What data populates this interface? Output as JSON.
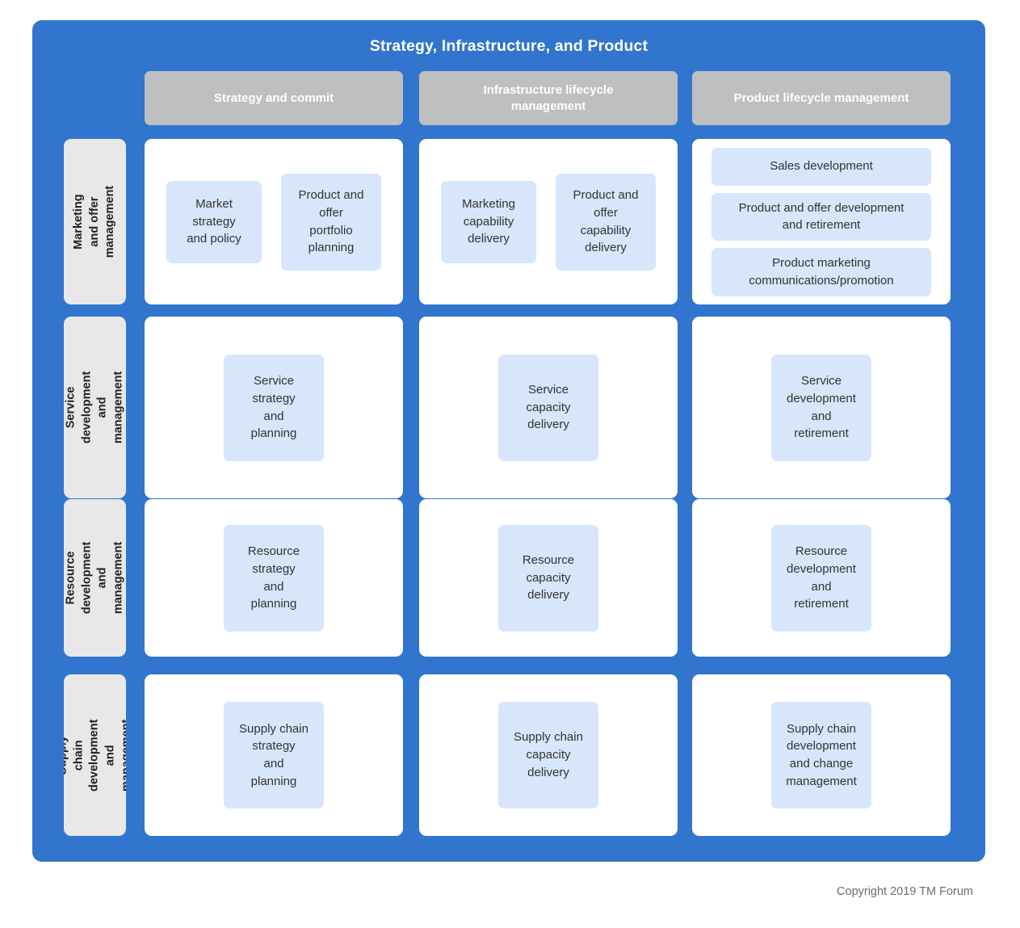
{
  "diagram": {
    "title": "Strategy, Infrastructure, and Product",
    "copyright": "Copyright 2019 TM Forum",
    "colors": {
      "frame_blue": "#3275ce",
      "column_header_gray": "#bebfc1",
      "row_label_gray": "#e8e8e8",
      "cell_white": "#ffffff",
      "item_light_blue": "#d7e6fb",
      "title_text": "#ffffff",
      "item_text": "#333333",
      "copyright_text": "#6d6d6d"
    }
  },
  "columns": [
    {
      "label": "Strategy and commit"
    },
    {
      "label": "Infrastructure lifecycle\nmanagement"
    },
    {
      "label": "Product lifecycle management"
    }
  ],
  "rows": [
    {
      "label": "Marketing and offer\nmanagement"
    },
    {
      "label": "Service development\nand management"
    },
    {
      "label": "Resource\ndevelopment and\nmanagement"
    },
    {
      "label": "Supply chain\ndevelopment and\nmanagement"
    }
  ],
  "cells": {
    "r1c1": {
      "items": [
        "Market\nstrategy\nand policy",
        "Product and\noffer\nportfolio\nplanning"
      ]
    },
    "r1c2": {
      "items": [
        "Marketing\ncapability\ndelivery",
        "Product and\noffer\ncapability\ndelivery"
      ]
    },
    "r1c3": {
      "items": [
        "Sales development",
        "Product and offer development\nand retirement",
        "Product marketing\ncommunications/promotion"
      ]
    },
    "r2c1": {
      "items": [
        "Service\nstrategy\nand\nplanning"
      ]
    },
    "r2c2": {
      "items": [
        "Service\ncapacity\ndelivery"
      ]
    },
    "r2c3": {
      "items": [
        "Service\ndevelopment\nand\nretirement"
      ]
    },
    "r3c1": {
      "items": [
        "Resource\nstrategy\nand\nplanning"
      ]
    },
    "r3c2": {
      "items": [
        "Resource\ncapacity\ndelivery"
      ]
    },
    "r3c3": {
      "items": [
        "Resource\ndevelopment\nand\nretirement"
      ]
    },
    "r4c1": {
      "items": [
        "Supply chain\nstrategy\nand\nplanning"
      ]
    },
    "r4c2": {
      "items": [
        "Supply chain\ncapacity\ndelivery"
      ]
    },
    "r4c3": {
      "items": [
        "Supply chain\ndevelopment\nand change\nmanagement"
      ]
    }
  }
}
